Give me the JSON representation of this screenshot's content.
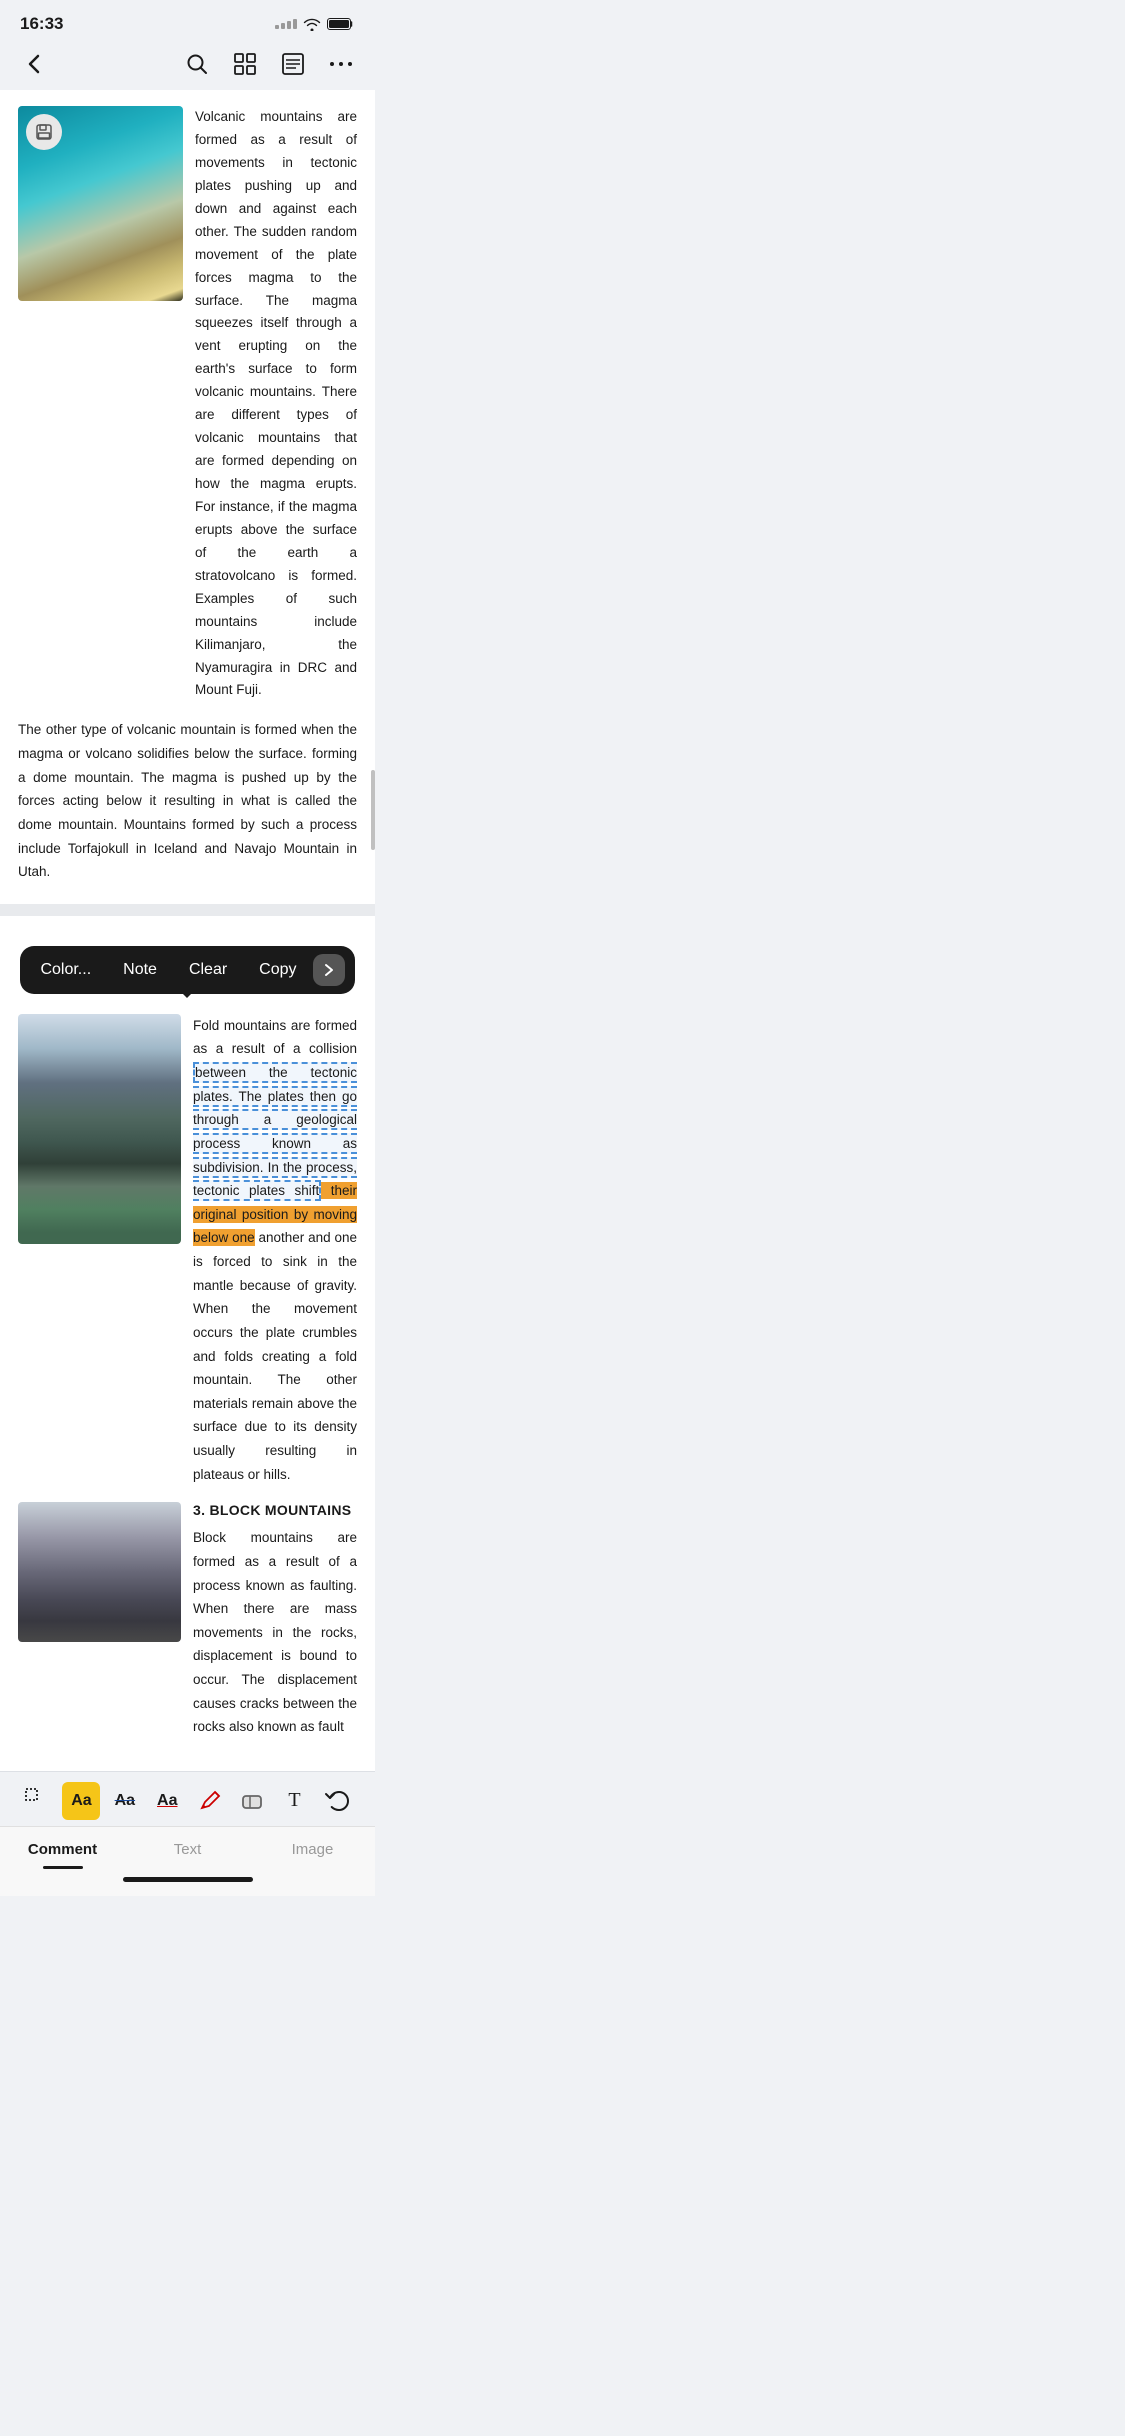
{
  "status": {
    "time": "16:33"
  },
  "nav": {
    "back_label": "←",
    "search_label": "search",
    "grid_label": "grid",
    "list_label": "list",
    "more_label": "more"
  },
  "content": {
    "para1": "Volcanic mountains are formed as a result of movements in tectonic plates pushing up and down and against each other. The sudden random movement of the plate forces magma to the surface. The magma squeezes itself through a vent erupting on the earth's surface to form volcanic mountains. There are different types of volcanic mountains that are formed depending on how the magma erupts. For instance, if the magma erupts above the surface of the earth a stratovolcano is formed. Examples of such mountains include Kilimanjaro, the Nyamuragira in DRC and Mount Fuji.",
    "para2": "The other type of volcanic mountain is formed when the magma or volcano solidifies below the surface. forming a dome mountain. The magma is pushed up by the forces acting below it resulting in what is called the dome mountain. Mountains formed by such a process include Torfajokull in Iceland and Navajo Mountain in Utah.",
    "fold_mountain_text_part1": "Fold mountains are formed as a result of a collision ",
    "fold_mountain_highlighted_blue": "between the tectonic plates. The plates then go through a geological process known as subdivision. In the process, tectonic plates shift",
    "fold_mountain_highlighted_orange": " their original position by moving below one",
    "fold_mountain_text_part2": " another and one is forced to sink in the mantle because of gravity. When the movement occurs the plate crumbles and folds creating a fold mountain. The other materials remain above the surface due to its density usually resulting in plateaus or hills.",
    "section3_heading": "3. BLOCK MOUNTAINS",
    "section3_para": "Block mountains are formed as a result of a process known as faulting. When there are mass movements in the rocks, displacement is bound to occur. The displacement causes cracks between the rocks also known as fault"
  },
  "toolbar": {
    "color_label": "Color...",
    "note_label": "Note",
    "clear_label": "Clear",
    "copy_label": "Copy"
  },
  "bottom_tools": [
    {
      "name": "selection-tool",
      "label": "□"
    },
    {
      "name": "highlight-yellow-tool",
      "label": "Aa"
    },
    {
      "name": "highlight-strikethrough-tool",
      "label": "Aa"
    },
    {
      "name": "text-tool",
      "label": "Aa"
    },
    {
      "name": "eraser-tool",
      "label": "✏"
    },
    {
      "name": "shape-tool",
      "label": "◇"
    },
    {
      "name": "insert-tool",
      "label": "T"
    },
    {
      "name": "undo-tool",
      "label": "↩"
    }
  ],
  "tabs": [
    {
      "name": "comment-tab",
      "label": "Comment",
      "active": true
    },
    {
      "name": "text-tab",
      "label": "Text",
      "active": false
    },
    {
      "name": "image-tab",
      "label": "Image",
      "active": false
    }
  ]
}
